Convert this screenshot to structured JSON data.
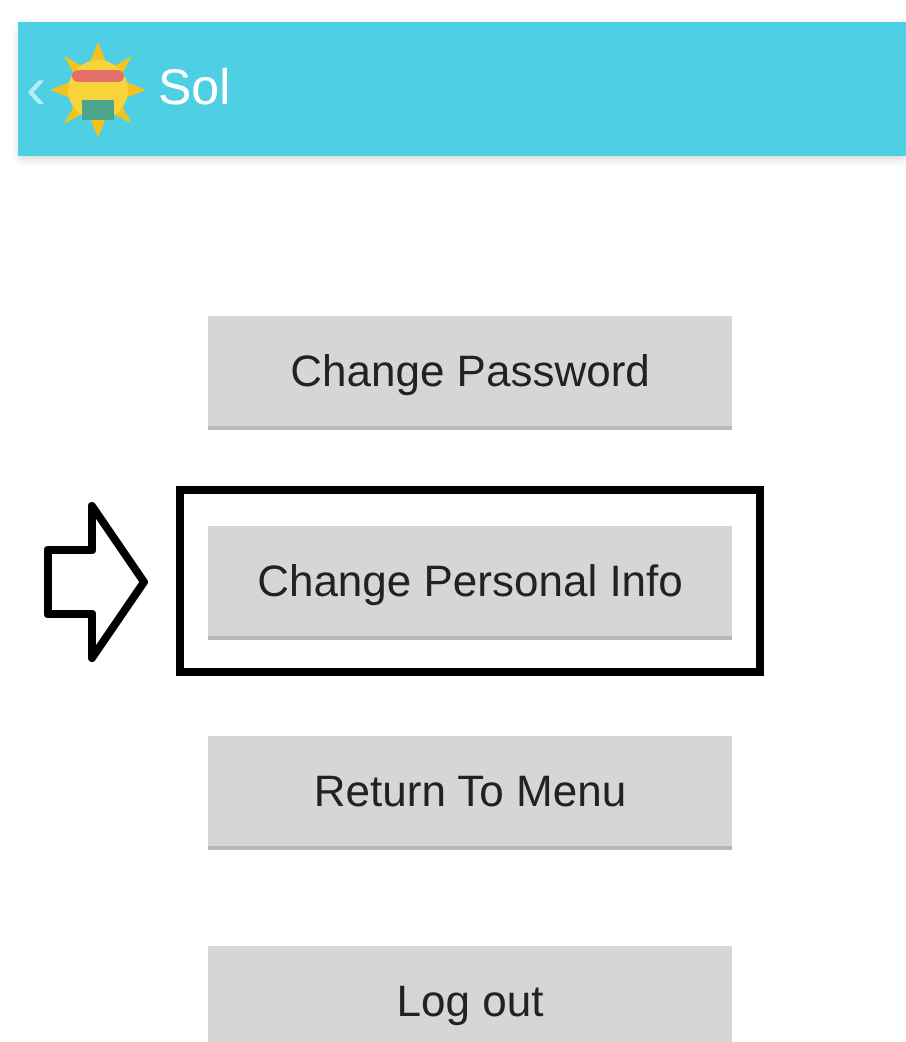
{
  "action_bar": {
    "back": "‹",
    "title": "Sol"
  },
  "buttons": [
    {
      "label": "Change Password",
      "highlighted": false
    },
    {
      "label": "Change Personal Info",
      "highlighted": true
    },
    {
      "label": "Return To Menu",
      "highlighted": false
    },
    {
      "label": "Log out",
      "highlighted": false
    }
  ]
}
